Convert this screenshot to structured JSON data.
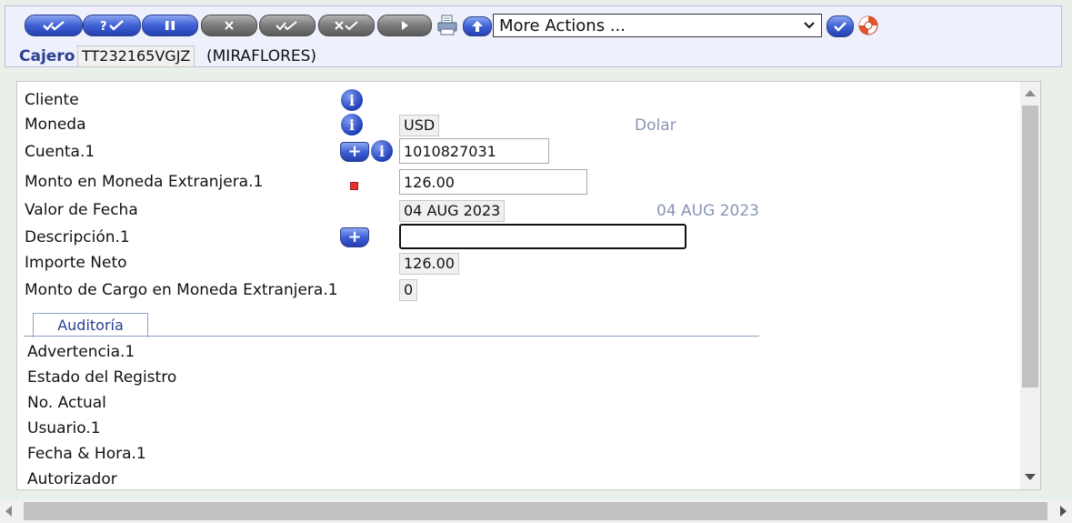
{
  "toolbar": {
    "buttons": [
      {
        "name": "commit",
        "glyph": "✔✔"
      },
      {
        "name": "validate",
        "glyph": "?✔"
      },
      {
        "name": "hold",
        "glyph": "❚❚"
      },
      {
        "name": "delete",
        "glyph": "✕"
      },
      {
        "name": "authorise",
        "glyph": "✔✔"
      },
      {
        "name": "reverse",
        "glyph": "✕✔"
      },
      {
        "name": "next",
        "glyph": "▶"
      }
    ],
    "actions_select": {
      "value": "More Actions ..."
    },
    "icons": [
      "print-icon",
      "upload-icon",
      "go-icon",
      "help-lifebuoy-icon"
    ]
  },
  "cashier": {
    "label": "Cajero",
    "id": "TT232165VGJZ",
    "branch": "(MIRAFLORES)"
  },
  "form": {
    "cliente": {
      "label": "Cliente"
    },
    "moneda": {
      "label": "Moneda",
      "value": "USD",
      "hint": "Dolar"
    },
    "cuenta": {
      "label": "Cuenta.1",
      "value": "1010827031"
    },
    "monto": {
      "label": "Monto en Moneda Extranjera.1",
      "value": "126.00"
    },
    "valor_fecha": {
      "label": "Valor de Fecha",
      "value": "04 AUG 2023",
      "hint": "04 AUG 2023"
    },
    "descripcion": {
      "label": "Descripción.1",
      "value": ""
    },
    "importe_neto": {
      "label": "Importe Neto",
      "value": "126.00"
    },
    "monto_cargo": {
      "label": "Monto de Cargo en Moneda Extranjera.1",
      "value": "0"
    }
  },
  "tabs": {
    "audit": {
      "label": "Auditoría"
    }
  },
  "audit": {
    "fields": [
      "Advertencia.1",
      "Estado del Registro",
      "No. Actual",
      "Usuario.1",
      "Fecha & Hora.1",
      "Autorizador"
    ]
  },
  "colors": {
    "accent": "#2a3f8f",
    "button_blue": "#3f60d4",
    "button_grey": "#7a7a7a",
    "hint": "#8894b4"
  }
}
